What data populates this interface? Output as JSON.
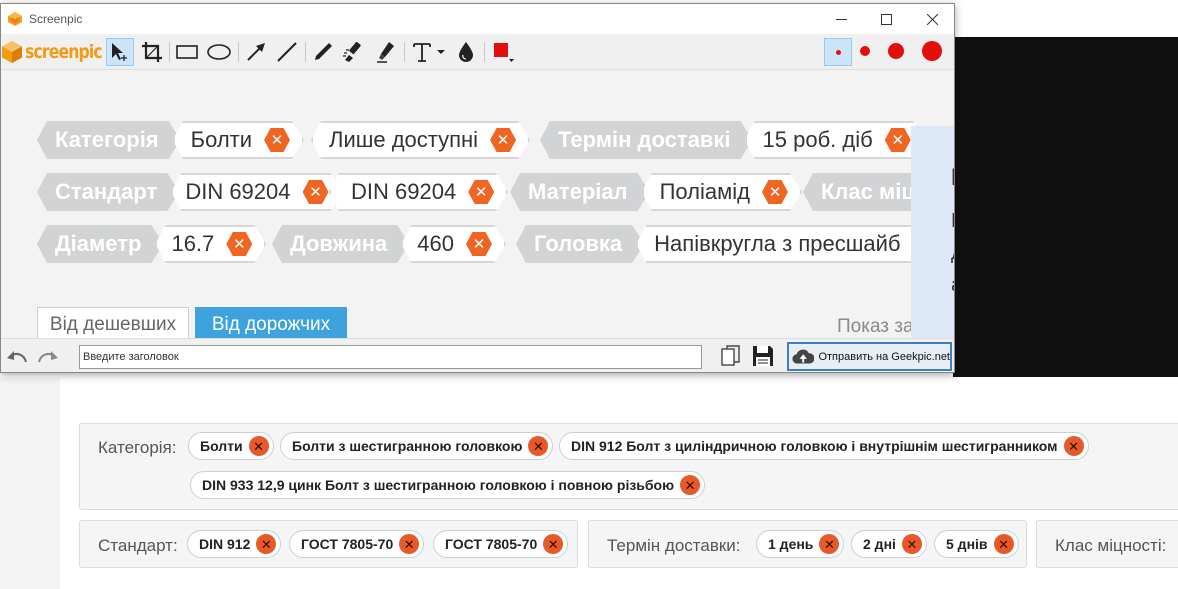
{
  "window": {
    "title": "Screenpic",
    "logo_text": "screenpic",
    "controls": [
      "minimize",
      "maximize",
      "close"
    ]
  },
  "toolbar": {
    "tools": [
      "select-tool",
      "crop-tool",
      "rectangle-tool",
      "ellipse-tool",
      "arrow-tool",
      "line-tool",
      "pen-tool",
      "blur-tool",
      "marker-tool",
      "text-tool",
      "droplet-tool",
      "color-picker"
    ],
    "active_tool": "select-tool",
    "active_size": "small",
    "color": "#e30e0e",
    "sizes": [
      "xs",
      "s",
      "m",
      "l"
    ]
  },
  "capture": {
    "tag_rows": [
      [
        {
          "key": "Категорія",
          "value": "Болти"
        },
        {
          "key": "",
          "value": "Лише доступні"
        },
        {
          "key": "Термін доставкі",
          "value": "15 роб. діб"
        }
      ],
      [
        {
          "key": "Стандарт",
          "value": "DIN 69204"
        },
        {
          "key": "",
          "value": "DIN 69204"
        },
        {
          "key": "Матеріал",
          "value": "Поліамід"
        },
        {
          "key": "Клас міц",
          "value": ""
        }
      ],
      [
        {
          "key": "Діаметр",
          "value": "16.7"
        },
        {
          "key": "Довжина",
          "value": "460"
        },
        {
          "key": "Головка",
          "value": "Напівкругла з пресшайб"
        }
      ]
    ],
    "sort_cheap": "Від дешевших",
    "sort_expensive": "Від дорожчих",
    "show_label": "Показ за",
    "side_panel_chars": [
      "I",
      "М",
      "д",
      "а"
    ]
  },
  "bottom": {
    "title_placeholder": "Введите заголовок",
    "send_label": "Отправить на Geekpic.net"
  },
  "page": {
    "row1_label": "Категорія:",
    "row1_pills": [
      "Болти",
      "Болти з шестигранною головкою",
      "DIN 912 Болт з циліндричною головкою і внутрішнім шестигранником",
      "DIN 933 12,9 цинк Болт з шестигранною головкою і повною різьбою"
    ],
    "row2a_label": "Стандарт:",
    "row2a_pills": [
      "DIN 912",
      "ГОСТ 7805-70",
      "ГОСТ 7805-70"
    ],
    "row2b_label": "Термін доставки:",
    "row2b_pills": [
      "1 день",
      "2 дні",
      "5 днів"
    ],
    "row2c_label": "Клас міцності:"
  }
}
